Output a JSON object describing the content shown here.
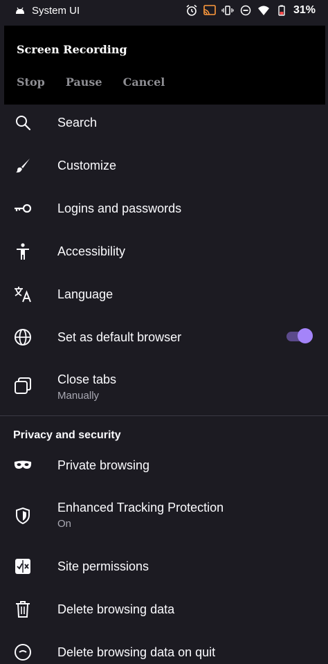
{
  "status_bar": {
    "app_label": "System UI",
    "battery": "31%"
  },
  "screen_recording": {
    "title": "Screen Recording",
    "stop": "Stop",
    "pause": "Pause",
    "cancel": "Cancel"
  },
  "settings": {
    "items": [
      {
        "label": "Search",
        "icon": "search-icon"
      },
      {
        "label": "Customize",
        "icon": "brush-icon"
      },
      {
        "label": "Logins and passwords",
        "icon": "key-icon"
      },
      {
        "label": "Accessibility",
        "icon": "accessibility-icon"
      },
      {
        "label": "Language",
        "icon": "language-icon"
      },
      {
        "label": "Set as default browser",
        "icon": "globe-icon",
        "toggle_on": true
      },
      {
        "label": "Close tabs",
        "sub": "Manually",
        "icon": "tabs-icon"
      }
    ],
    "privacy_header": "Privacy and security",
    "privacy_items": [
      {
        "label": "Private browsing",
        "icon": "mask-icon"
      },
      {
        "label": "Enhanced Tracking Protection",
        "sub": "On",
        "icon": "shield-icon"
      },
      {
        "label": "Site permissions",
        "icon": "permissions-icon"
      },
      {
        "label": "Delete browsing data",
        "icon": "trash-icon"
      },
      {
        "label": "Delete browsing data on quit",
        "icon": "trash-quit-icon"
      }
    ]
  },
  "colors": {
    "background": "#1c1b22",
    "accent": "#a484f9"
  }
}
